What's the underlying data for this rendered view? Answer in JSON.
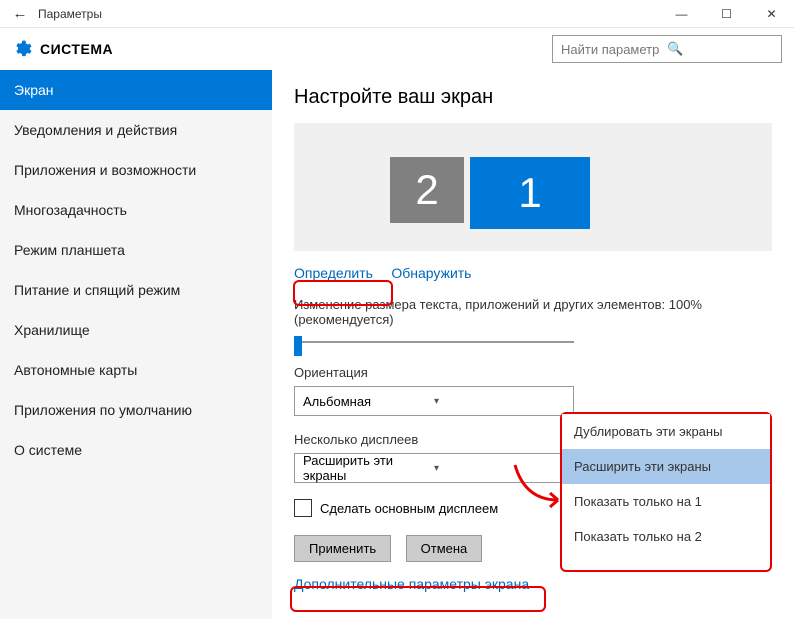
{
  "window": {
    "title": "Параметры",
    "controls": {
      "minimize": "—",
      "maximize": "☐",
      "close": "✕"
    }
  },
  "header": {
    "section": "СИСТЕМА",
    "search_placeholder": "Найти параметр"
  },
  "sidebar": {
    "items": [
      {
        "label": "Экран",
        "active": true
      },
      {
        "label": "Уведомления и действия"
      },
      {
        "label": "Приложения и возможности"
      },
      {
        "label": "Многозадачность"
      },
      {
        "label": "Режим планшета"
      },
      {
        "label": "Питание и спящий режим"
      },
      {
        "label": "Хранилище"
      },
      {
        "label": "Автономные карты"
      },
      {
        "label": "Приложения по умолчанию"
      },
      {
        "label": "О системе"
      }
    ]
  },
  "main": {
    "title": "Настройте ваш экран",
    "monitors": {
      "m1": "1",
      "m2": "2"
    },
    "identify_label": "Определить",
    "detect_label": "Обнаружить",
    "scale_label": "Изменение размера текста, приложений и других элементов: 100% (рекомендуется)",
    "orientation_label": "Ориентация",
    "orientation_value": "Альбомная",
    "multi_label": "Несколько дисплеев",
    "multi_value": "Расширить эти экраны",
    "make_main_label": "Сделать основным дисплеем",
    "apply_label": "Применить",
    "cancel_label": "Отмена",
    "advanced_label": "Дополнительные параметры экрана"
  },
  "popup": {
    "opt1": "Дублировать эти экраны",
    "opt2": "Расширить эти экраны",
    "opt3": "Показать только на 1",
    "opt4": "Показать только на 2"
  }
}
